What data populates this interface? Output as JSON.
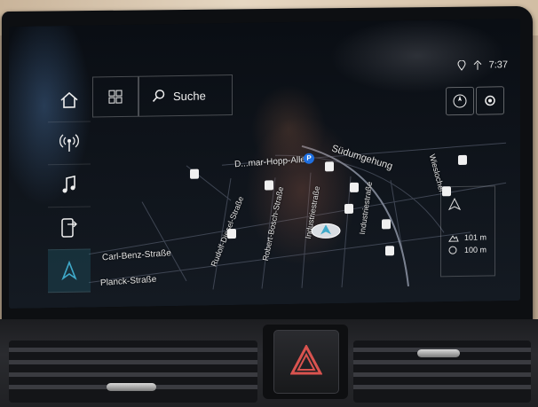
{
  "status": {
    "time": "7:37"
  },
  "search": {
    "label": "Suche"
  },
  "map": {
    "streets": [
      "D...mar-Hopp-Allee",
      "Südumgehung",
      "Carl-Benz-Straße",
      "Planck-Straße",
      "Rudolf-Diesel-Straße",
      "Robert-Bosch-Straße",
      "Industriestraße",
      "Industriestraße",
      "Wieslocher"
    ],
    "parking_symbol": "P"
  },
  "scale": {
    "top": "101 m",
    "bottom": "100 m"
  },
  "sidebar": {
    "items": [
      "home-icon",
      "radio-icon",
      "music-icon",
      "phone-icon",
      "navigation-icon"
    ]
  },
  "colors": {
    "accent": "#3fa9c9",
    "screen_bg": "#07090c"
  }
}
